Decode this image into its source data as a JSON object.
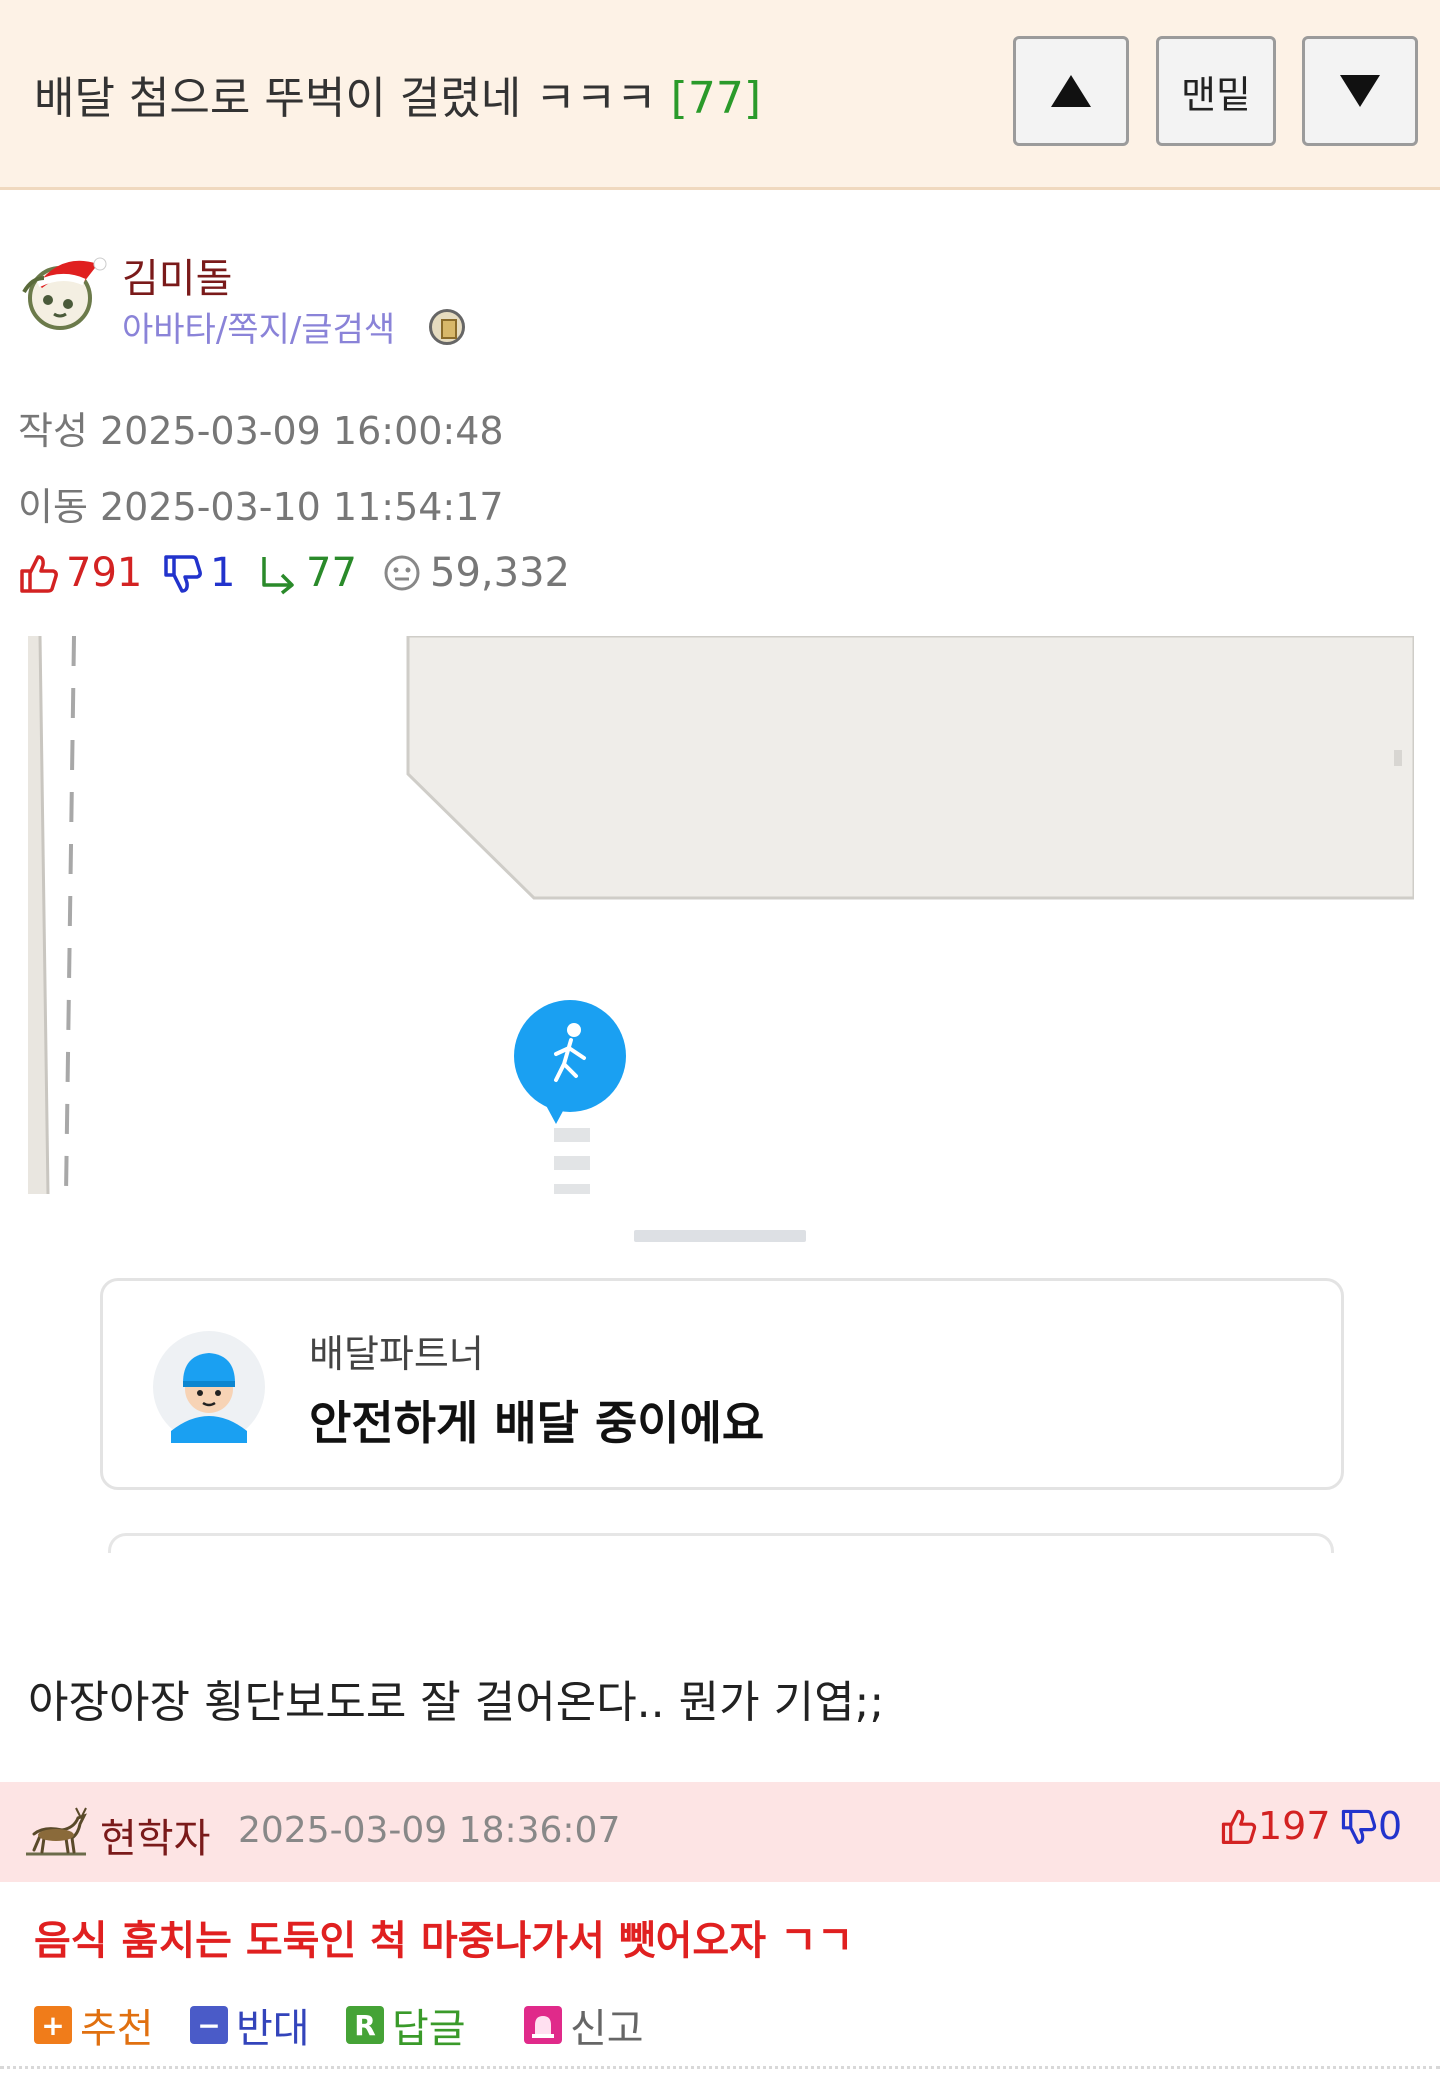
{
  "post": {
    "title": "배달 첨으로 뚜벅이 걸렸네 ㅋㅋㅋ",
    "comment_count": "[77]"
  },
  "nav": {
    "up_icon": "triangle-up-icon",
    "bottom_label": "맨밑",
    "down_icon": "triangle-down-icon"
  },
  "author": {
    "name": "김미돌",
    "links": "아바타/쪽지/글검색"
  },
  "meta": {
    "created": "작성 2025-03-09 16:00:48",
    "moved": "이동 2025-03-10 11:54:17"
  },
  "stats": {
    "likes": "791",
    "dislikes": "1",
    "replies": "77",
    "views": "59,332"
  },
  "screenshot": {
    "sublabel": "배달파트너",
    "status": "안전하게 배달 중이에요"
  },
  "body_text": "아장아장 횡단보도로 잘 걸어온다.. 뭔가 기엽;;",
  "comment": {
    "author": "현학자",
    "date": "2025-03-09 18:36:07",
    "likes": "197",
    "dislikes": "0",
    "text": "음식 훔치는 도둑인 척 마중나가서 뺏어오자 ㄱㄱ"
  },
  "actions": {
    "recommend": "추천",
    "oppose": "반대",
    "reply": "답글",
    "report": "신고"
  },
  "colors": {
    "header_bg": "#fdf2e6",
    "comment_bg": "#fde4e4",
    "like_red": "#d32222",
    "dislike_blue": "#2233cc",
    "reply_green": "#2a8a2a",
    "pin_blue": "#1aa0f2"
  }
}
